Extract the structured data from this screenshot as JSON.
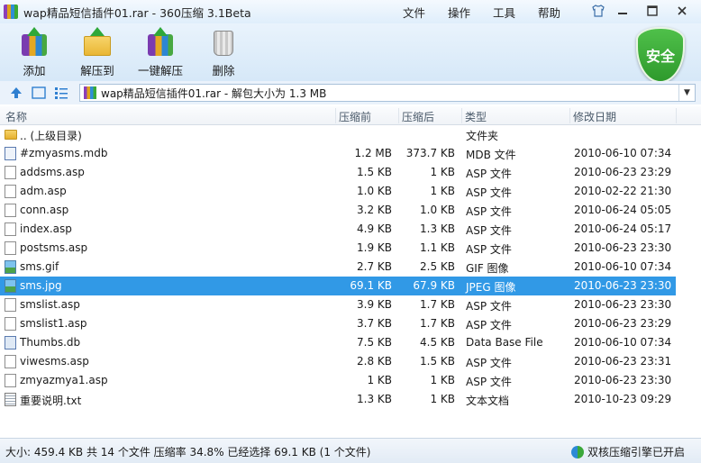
{
  "window": {
    "title": "wap精品短信插件01.rar - 360压缩 3.1Beta",
    "menu": [
      "文件",
      "操作",
      "工具",
      "帮助"
    ]
  },
  "toolbar": {
    "add_label": "添加",
    "extract_label": "解压到",
    "oneclick_label": "一键解压",
    "delete_label": "删除",
    "security_label": "安全"
  },
  "address": {
    "path": "wap精品短信插件01.rar - 解包大小为 1.3 MB"
  },
  "columns": {
    "name": "名称",
    "compressed": "压缩前",
    "packed": "压缩后",
    "type": "类型",
    "modified": "修改日期"
  },
  "files": [
    {
      "name": ".. (上级目录)",
      "compressed": "",
      "packed": "",
      "type": "文件夹",
      "date": "",
      "icon": "folder-icon"
    },
    {
      "name": "#zmyasms.mdb",
      "compressed": "1.2 MB",
      "packed": "373.7 KB",
      "type": "MDB 文件",
      "date": "2010-06-10 07:34",
      "icon": "mdb-file-icon"
    },
    {
      "name": "addsms.asp",
      "compressed": "1.5 KB",
      "packed": "1 KB",
      "type": "ASP 文件",
      "date": "2010-06-23 23:29",
      "icon": "file-icon"
    },
    {
      "name": "adm.asp",
      "compressed": "1.0 KB",
      "packed": "1 KB",
      "type": "ASP 文件",
      "date": "2010-02-22 21:30",
      "icon": "file-icon"
    },
    {
      "name": "conn.asp",
      "compressed": "3.2 KB",
      "packed": "1.0 KB",
      "type": "ASP 文件",
      "date": "2010-06-24 05:05",
      "icon": "file-icon"
    },
    {
      "name": "index.asp",
      "compressed": "4.9 KB",
      "packed": "1.3 KB",
      "type": "ASP 文件",
      "date": "2010-06-24 05:17",
      "icon": "file-icon"
    },
    {
      "name": "postsms.asp",
      "compressed": "1.9 KB",
      "packed": "1.1 KB",
      "type": "ASP 文件",
      "date": "2010-06-23 23:30",
      "icon": "file-icon"
    },
    {
      "name": "sms.gif",
      "compressed": "2.7 KB",
      "packed": "2.5 KB",
      "type": "GIF 图像",
      "date": "2010-06-10 07:34",
      "icon": "image-icon"
    },
    {
      "name": "sms.jpg",
      "compressed": "69.1 KB",
      "packed": "67.9 KB",
      "type": "JPEG 图像",
      "date": "2010-06-23 23:30",
      "icon": "image-icon",
      "selected": true
    },
    {
      "name": "smslist.asp",
      "compressed": "3.9 KB",
      "packed": "1.7 KB",
      "type": "ASP 文件",
      "date": "2010-06-23 23:30",
      "icon": "file-icon"
    },
    {
      "name": "smslist1.asp",
      "compressed": "3.7 KB",
      "packed": "1.7 KB",
      "type": "ASP 文件",
      "date": "2010-06-23 23:29",
      "icon": "file-icon"
    },
    {
      "name": "Thumbs.db",
      "compressed": "7.5 KB",
      "packed": "4.5 KB",
      "type": "Data Base File",
      "date": "2010-06-10 07:34",
      "icon": "database-icon"
    },
    {
      "name": "viwesms.asp",
      "compressed": "2.8 KB",
      "packed": "1.5 KB",
      "type": "ASP 文件",
      "date": "2010-06-23 23:31",
      "icon": "file-icon"
    },
    {
      "name": "zmyazmya1.asp",
      "compressed": "1 KB",
      "packed": "1 KB",
      "type": "ASP 文件",
      "date": "2010-06-23 23:30",
      "icon": "file-icon"
    },
    {
      "name": "重要说明.txt",
      "compressed": "1.3 KB",
      "packed": "1 KB",
      "type": "文本文档",
      "date": "2010-10-23 09:29",
      "icon": "text-file-icon"
    }
  ],
  "status": {
    "summary": "大小: 459.4 KB 共 14 个文件 压缩率 34.8% 已经选择 69.1 KB (1 个文件)",
    "engine": "双核压缩引擎已开启"
  },
  "colors": {
    "selection": "#3199e6",
    "security_green": "#3aa83a"
  }
}
